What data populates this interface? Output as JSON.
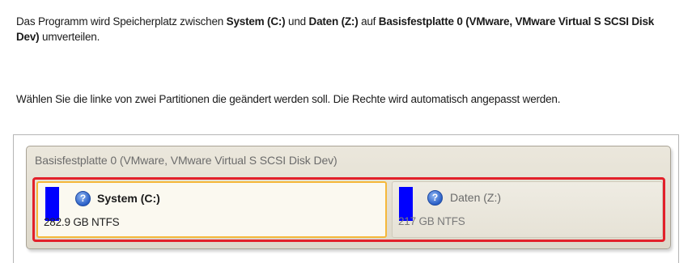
{
  "intro": {
    "part1": "Das Programm wird Speicherplatz zwischen ",
    "partition_a": "System (C:)",
    "part2": " und ",
    "partition_b": "Daten (Z:)",
    "part3": " auf ",
    "disk": "Basisfestplatte 0 (VMware, VMware Virtual S SCSI Disk Dev)",
    "part4": " umverteilen."
  },
  "instruction": "Wählen Sie die linke von zwei Partitionen die geändert werden soll. Die Rechte wird automatisch angepasst werden.",
  "disk_box": {
    "title": "Basisfestplatte 0 (VMware, VMware Virtual S SCSI Disk Dev)"
  },
  "partitions": [
    {
      "name": "System (C:)",
      "size": "282.9 GB NTFS",
      "color": "#0000ff",
      "icon": "help-icon",
      "selected": true
    },
    {
      "name": "Daten (Z:)",
      "size": "217 GB NTFS",
      "color": "#0000ff",
      "icon": "help-icon",
      "selected": false
    }
  ],
  "colors": {
    "selection_border": "#e2202a",
    "selected_partition_border": "#f5b83a",
    "partition_color": "#0000ff"
  }
}
